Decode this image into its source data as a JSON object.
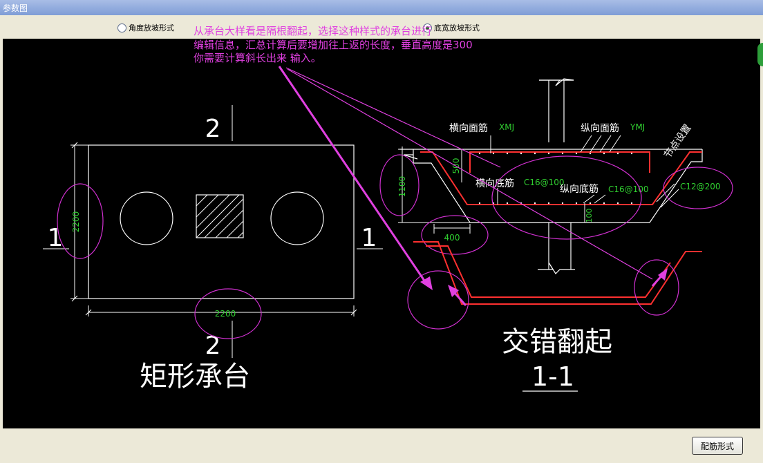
{
  "window": {
    "title": "参数图"
  },
  "options": [
    {
      "label": "角度放坡形式",
      "selected": false
    },
    {
      "label": "底宽放坡形式",
      "selected": true
    }
  ],
  "annotation": [
    "从承台大样看是隔根翻起，选择这种样式的承台进行",
    "编辑信息，汇总计算后要增加往上返的长度，垂直高度是300",
    "你需要计算斜长出来 输入。"
  ],
  "plan": {
    "section_top": "2",
    "section_bottom": "2",
    "section_left": "1",
    "section_right": "1",
    "dim_height": "2200",
    "dim_width": "2200",
    "caption": "矩形承台"
  },
  "section": {
    "label_hxmj": "横向面筋",
    "code_xmj": "XMJ",
    "label_zxmj": "纵向面筋",
    "code_ymj": "YMJ",
    "label_hxdj": "横向底筋",
    "code_hxdj": "C16@100",
    "label_zxdj": "纵向底筋",
    "code_zxdj": "C16@100",
    "label_node": "节点设置",
    "code_stirrup": "C12@200",
    "dim_500": "500",
    "dim_1100": "1100",
    "dim_400": "400",
    "dim_100": "100",
    "caption_main": "交错翻起",
    "caption_sub": "1-1"
  },
  "footer": {
    "button_label": "配筋形式"
  }
}
